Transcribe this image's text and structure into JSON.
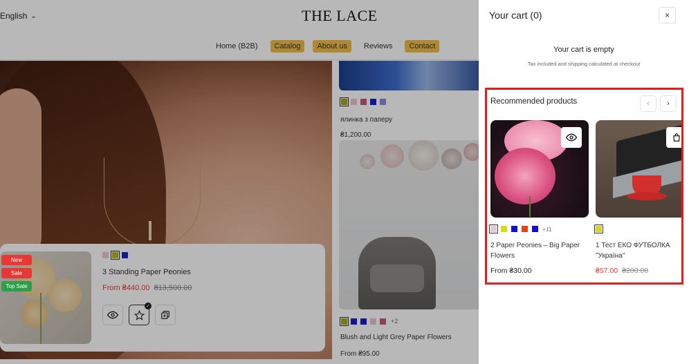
{
  "header": {
    "language": "English",
    "logo": "THE LACE",
    "nav": [
      {
        "label": "Home (B2B)",
        "highlight": false
      },
      {
        "label": "Catalog",
        "highlight": true
      },
      {
        "label": "About us",
        "highlight": true
      },
      {
        "label": "Reviews",
        "highlight": false
      },
      {
        "label": "Contact",
        "highlight": true
      }
    ]
  },
  "featured_card": {
    "badges": [
      "New",
      "Sale",
      "Top Sale"
    ],
    "swatches": [
      "#e8c7d7",
      "#b8b81f",
      "#1426c9"
    ],
    "title": "3 Standing Paper Peonies",
    "price": "From ₴440.00",
    "old_price": "₴13,500.00"
  },
  "right_column": {
    "product1": {
      "swatches": [
        "#a3a817",
        "#e8c4d4",
        "#c4577a",
        "#1a1ec9",
        "#8a8ae0"
      ],
      "title": "ялинка з паперу",
      "price": "₴1,200.00"
    },
    "product2": {
      "swatches": [
        "#a3a817",
        "#1a1ec9",
        "#1a1ec9",
        "#e8c4d4",
        "#c4577a"
      ],
      "more": "+2",
      "title": "Blush and Light Grey Paper Flowers",
      "price": "From ₴95.00"
    }
  },
  "cart": {
    "title": "Your cart (0)",
    "close": "×",
    "empty_message": "Your cart is empty",
    "tax_note": "Tax included and shipping calculated at checkout",
    "recommended": {
      "title": "Recommended products",
      "prev": "‹",
      "next": "›",
      "products": [
        {
          "swatches": [
            "#e8c4d8",
            "#d9d90f",
            "#1010d6",
            "#e84410",
            "#1010d6"
          ],
          "more": "+11",
          "title": "2 Paper Peonies – Big Paper Flowers",
          "price": "From ₴30.00"
        },
        {
          "swatches": [
            "#d8d22a"
          ],
          "title": "1 Тест ЕКО ФУТБОЛКА \"Україна\"",
          "price": "₴57.00",
          "old_price": "₴200.00"
        }
      ]
    }
  },
  "colors": {
    "accent": "#f2bd46",
    "sale": "#e53935",
    "highlight_border": "#e11d1d"
  }
}
